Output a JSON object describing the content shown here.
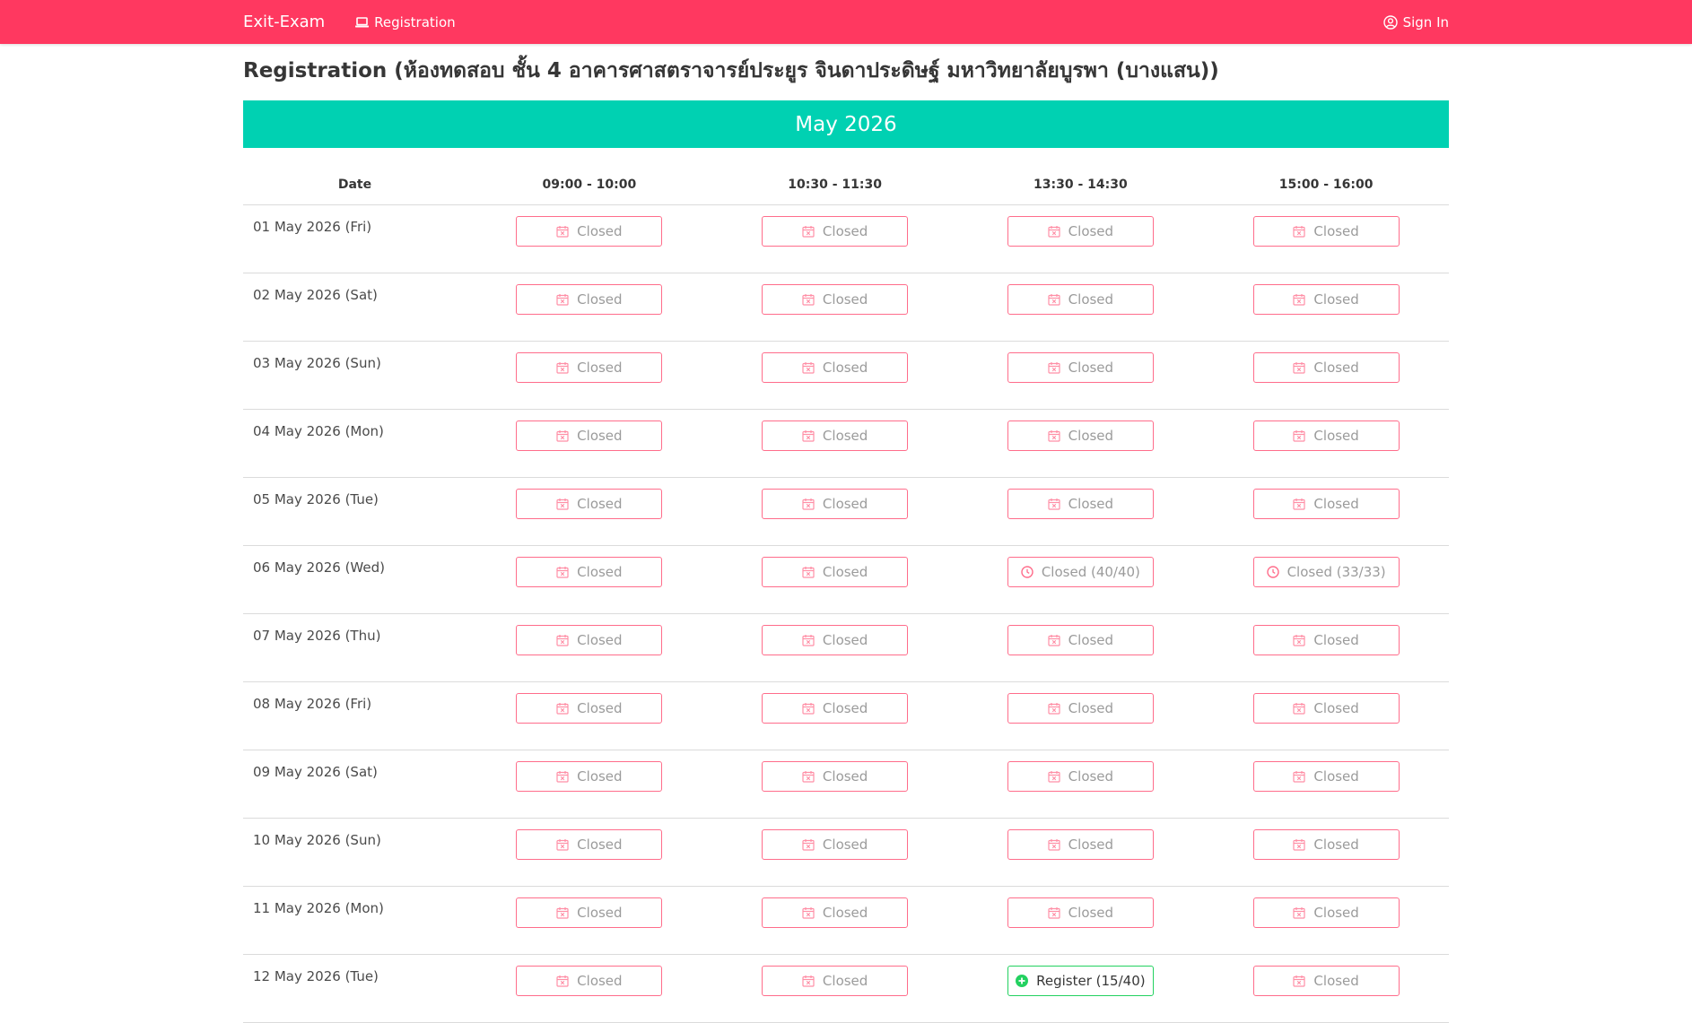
{
  "nav": {
    "brand": "Exit-Exam",
    "registration_link": "Registration",
    "signin": "Sign In"
  },
  "page": {
    "title": "Registration (ห้องทดสอบ ชั้น 4 อาคารศาสตราจารย์ประยูร จินดาประดิษฐ์ มหาวิทยาลัยบูรพา (บางแสน))",
    "month": "May 2026"
  },
  "table": {
    "headers": [
      "Date",
      "09:00 - 10:00",
      "10:30 - 11:30",
      "13:30 - 14:30",
      "15:00 - 16:00"
    ],
    "rows": [
      {
        "date": "01 May 2026 (Fri)",
        "slots": [
          {
            "label": "Closed",
            "type": "closed"
          },
          {
            "label": "Closed",
            "type": "closed"
          },
          {
            "label": "Closed",
            "type": "closed"
          },
          {
            "label": "Closed",
            "type": "closed"
          }
        ]
      },
      {
        "date": "02 May 2026 (Sat)",
        "slots": [
          {
            "label": "Closed",
            "type": "closed"
          },
          {
            "label": "Closed",
            "type": "closed"
          },
          {
            "label": "Closed",
            "type": "closed"
          },
          {
            "label": "Closed",
            "type": "closed"
          }
        ]
      },
      {
        "date": "03 May 2026 (Sun)",
        "slots": [
          {
            "label": "Closed",
            "type": "closed"
          },
          {
            "label": "Closed",
            "type": "closed"
          },
          {
            "label": "Closed",
            "type": "closed"
          },
          {
            "label": "Closed",
            "type": "closed"
          }
        ]
      },
      {
        "date": "04 May 2026 (Mon)",
        "slots": [
          {
            "label": "Closed",
            "type": "closed"
          },
          {
            "label": "Closed",
            "type": "closed"
          },
          {
            "label": "Closed",
            "type": "closed"
          },
          {
            "label": "Closed",
            "type": "closed"
          }
        ]
      },
      {
        "date": "05 May 2026 (Tue)",
        "slots": [
          {
            "label": "Closed",
            "type": "closed"
          },
          {
            "label": "Closed",
            "type": "closed"
          },
          {
            "label": "Closed",
            "type": "closed"
          },
          {
            "label": "Closed",
            "type": "closed"
          }
        ]
      },
      {
        "date": "06 May 2026 (Wed)",
        "slots": [
          {
            "label": "Closed",
            "type": "closed"
          },
          {
            "label": "Closed",
            "type": "closed"
          },
          {
            "label": "Closed (40/40)",
            "type": "full"
          },
          {
            "label": "Closed (33/33)",
            "type": "full"
          }
        ]
      },
      {
        "date": "07 May 2026 (Thu)",
        "slots": [
          {
            "label": "Closed",
            "type": "closed"
          },
          {
            "label": "Closed",
            "type": "closed"
          },
          {
            "label": "Closed",
            "type": "closed"
          },
          {
            "label": "Closed",
            "type": "closed"
          }
        ]
      },
      {
        "date": "08 May 2026 (Fri)",
        "slots": [
          {
            "label": "Closed",
            "type": "closed"
          },
          {
            "label": "Closed",
            "type": "closed"
          },
          {
            "label": "Closed",
            "type": "closed"
          },
          {
            "label": "Closed",
            "type": "closed"
          }
        ]
      },
      {
        "date": "09 May 2026 (Sat)",
        "slots": [
          {
            "label": "Closed",
            "type": "closed"
          },
          {
            "label": "Closed",
            "type": "closed"
          },
          {
            "label": "Closed",
            "type": "closed"
          },
          {
            "label": "Closed",
            "type": "closed"
          }
        ]
      },
      {
        "date": "10 May 2026 (Sun)",
        "slots": [
          {
            "label": "Closed",
            "type": "closed"
          },
          {
            "label": "Closed",
            "type": "closed"
          },
          {
            "label": "Closed",
            "type": "closed"
          },
          {
            "label": "Closed",
            "type": "closed"
          }
        ]
      },
      {
        "date": "11 May 2026 (Mon)",
        "slots": [
          {
            "label": "Closed",
            "type": "closed"
          },
          {
            "label": "Closed",
            "type": "closed"
          },
          {
            "label": "Closed",
            "type": "closed"
          },
          {
            "label": "Closed",
            "type": "closed"
          }
        ]
      },
      {
        "date": "12 May 2026 (Tue)",
        "slots": [
          {
            "label": "Closed",
            "type": "closed"
          },
          {
            "label": "Closed",
            "type": "closed"
          },
          {
            "label": "Register (15/40)",
            "type": "register"
          },
          {
            "label": "Closed",
            "type": "closed"
          }
        ]
      }
    ]
  },
  "colors": {
    "navbar": "#ff3860",
    "banner": "#00d1b2",
    "closed_border": "#ff6d8b",
    "register_border": "#23d160"
  },
  "icons": {
    "closed": "calendar-x-icon",
    "full": "clock-icon",
    "register": "plus-circle-icon"
  }
}
